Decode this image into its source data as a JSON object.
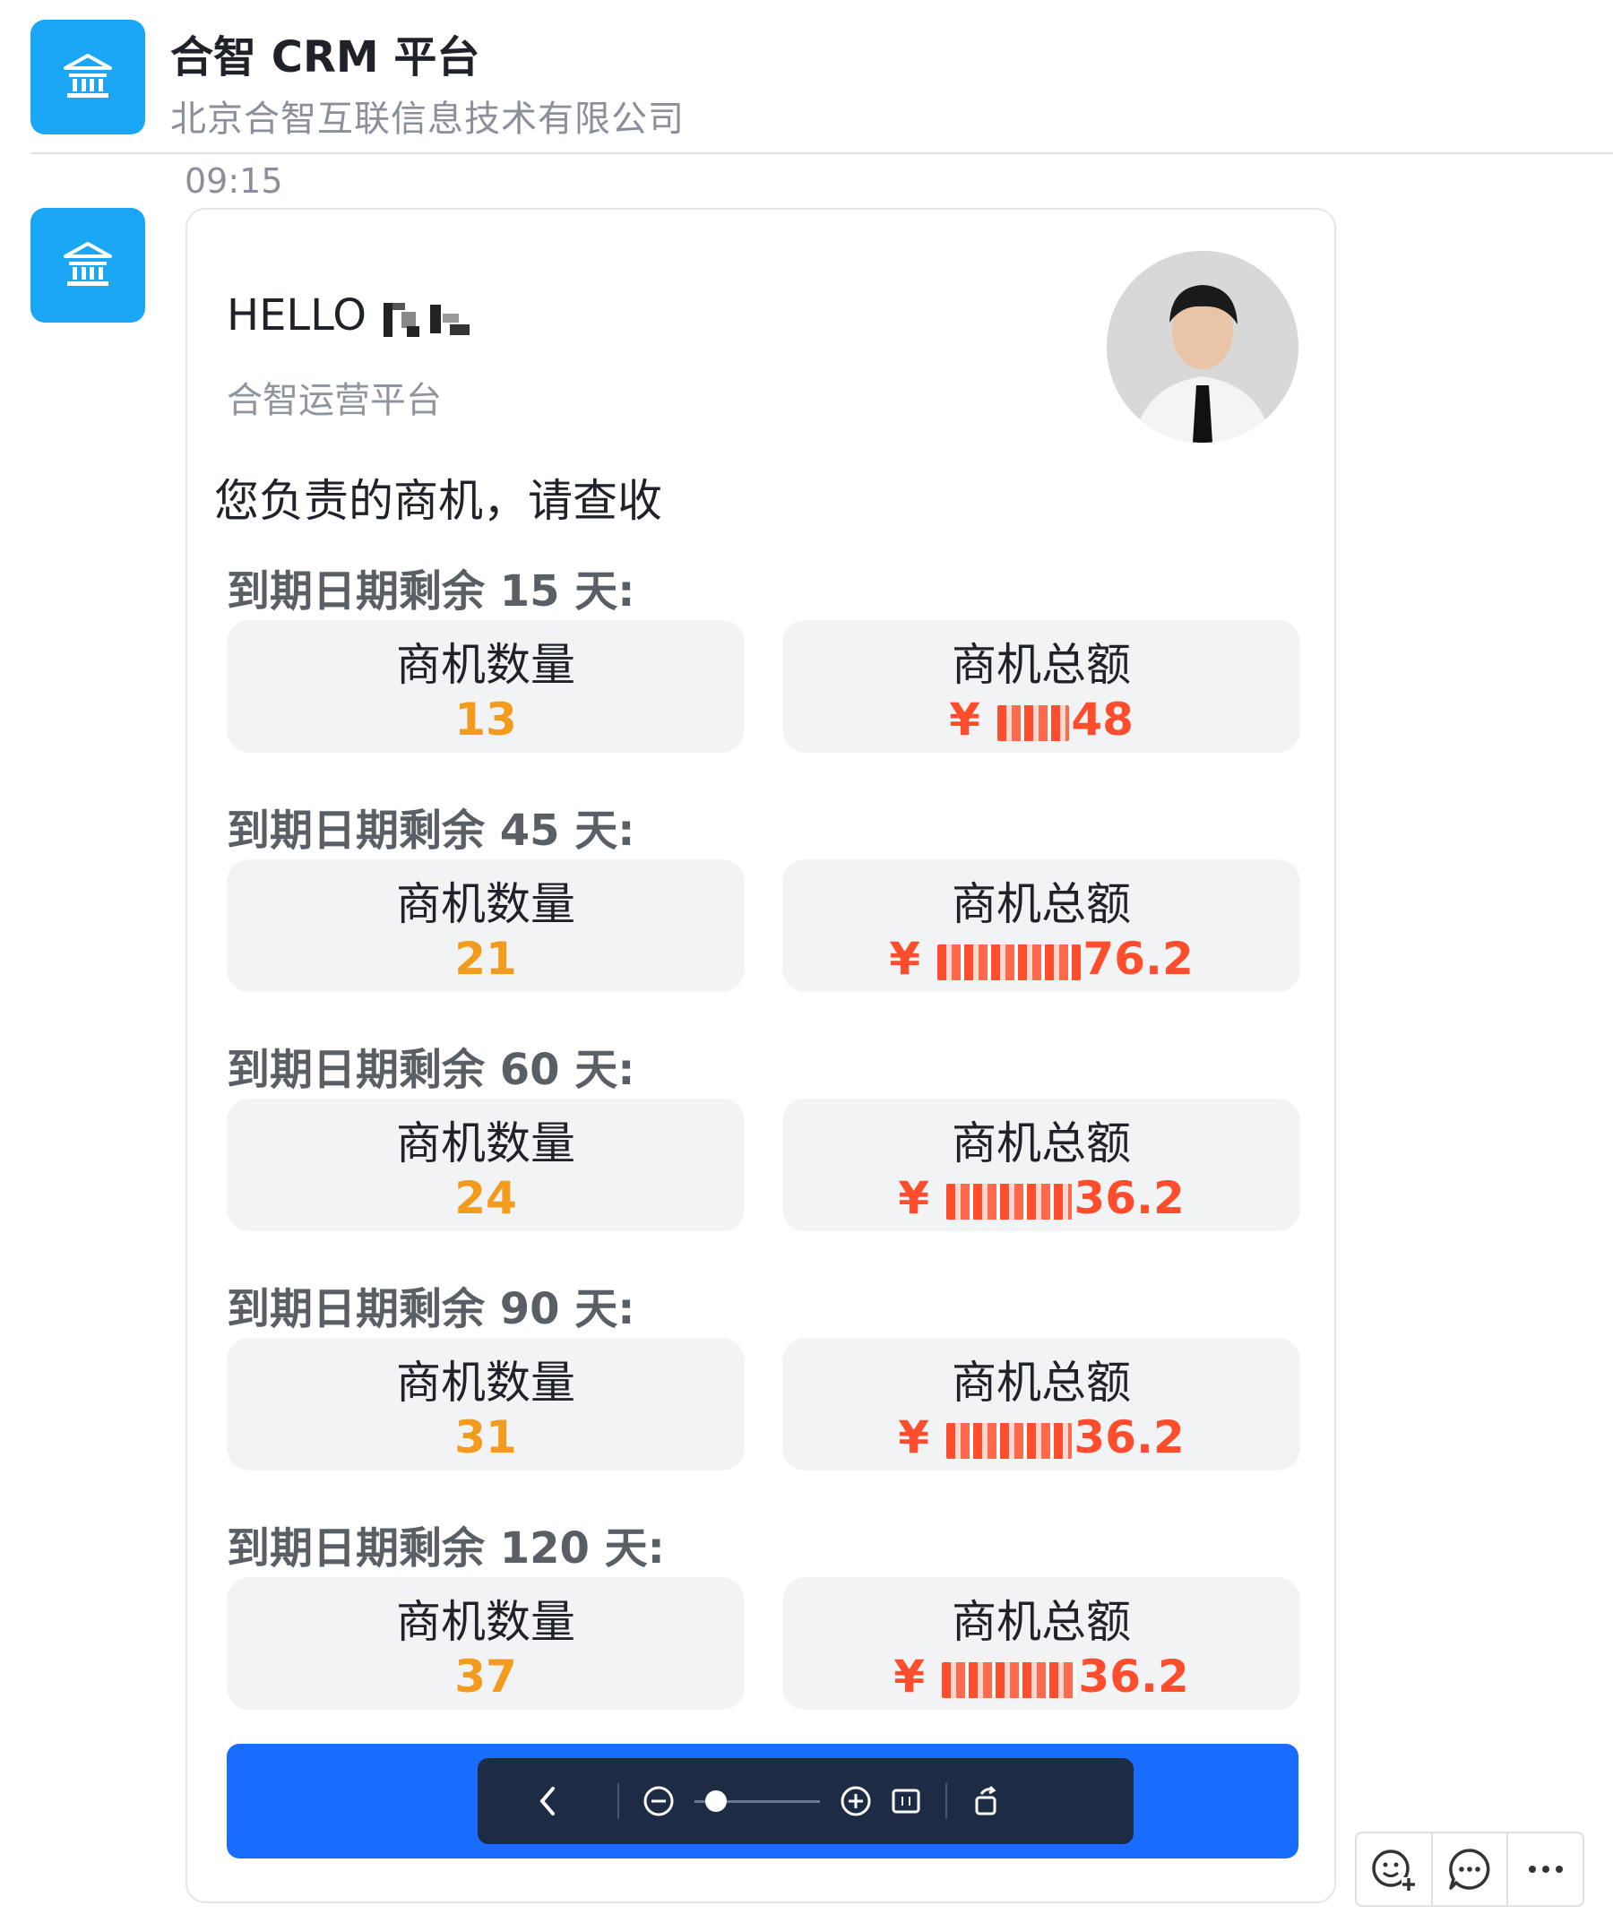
{
  "header": {
    "app_title": "合智 CRM 平台",
    "company": "北京合智互联信息技术有限公司",
    "icon": "bank-building-icon"
  },
  "message": {
    "time": "09:15"
  },
  "card": {
    "greeting": "HELLO",
    "platform": "合智运营平台",
    "lead": "您负责的商机，请查收",
    "count_title": "商机数量",
    "amount_title": "商机总额",
    "sections": [
      {
        "label": "到期日期剩余 15 天:",
        "count": "13",
        "amount_prefix": "¥",
        "amount_tail": "48"
      },
      {
        "label": "到期日期剩余 45 天:",
        "count": "21",
        "amount_prefix": "¥",
        "amount_tail": "76.2"
      },
      {
        "label": "到期日期剩余 60 天:",
        "count": "24",
        "amount_prefix": "¥",
        "amount_tail": "36.2"
      },
      {
        "label": "到期日期剩余 90 天:",
        "count": "31",
        "amount_prefix": "¥",
        "amount_tail": "36.2"
      },
      {
        "label": "到期日期剩余 120 天:",
        "count": "37",
        "amount_prefix": "¥",
        "amount_tail": "36.2"
      }
    ]
  },
  "colors": {
    "accent_blue": "#1a6cff",
    "app_icon": "#1aa7f5",
    "count_orange": "#f29b1d",
    "amount_red": "#ff4d2e",
    "toolbar_navy": "#1d2b45"
  },
  "viewer_toolbar": {
    "icons": [
      "chevron-left-icon",
      "zoom-out-icon",
      "zoom-slider",
      "zoom-in-icon",
      "fit-screen-icon",
      "rotate-icon"
    ]
  },
  "message_actions": {
    "icons": [
      "add-reaction-icon",
      "reply-icon",
      "more-icon"
    ]
  }
}
